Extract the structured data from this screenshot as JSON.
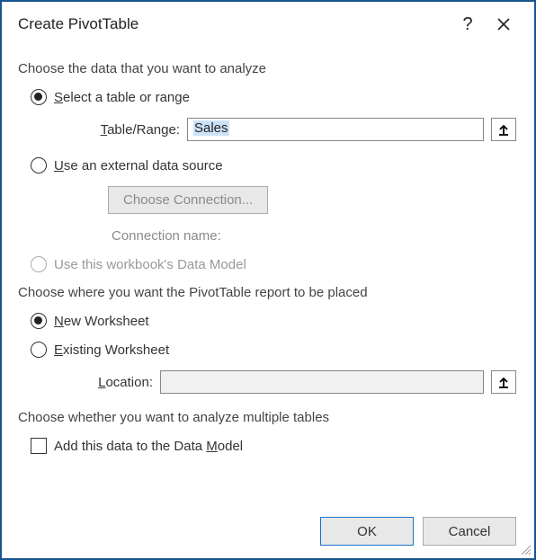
{
  "title": "Create PivotTable",
  "section1": "Choose the data that you want to analyze",
  "opt_select_table": "Select a table or range",
  "table_range_label": "Table/Range:",
  "table_range_value": "Sales",
  "opt_external": "Use an external data source",
  "choose_connection": "Choose Connection...",
  "connection_name_label": "Connection name:",
  "opt_data_model": "Use this workbook's Data Model",
  "section2": "Choose where you want the PivotTable report to be placed",
  "opt_new_ws": "New Worksheet",
  "opt_existing_ws": "Existing Worksheet",
  "location_label": "Location:",
  "location_value": "",
  "section3": "Choose whether you want to analyze multiple tables",
  "chk_add_model": "Add this data to the Data Model",
  "btn_ok": "OK",
  "btn_cancel": "Cancel"
}
